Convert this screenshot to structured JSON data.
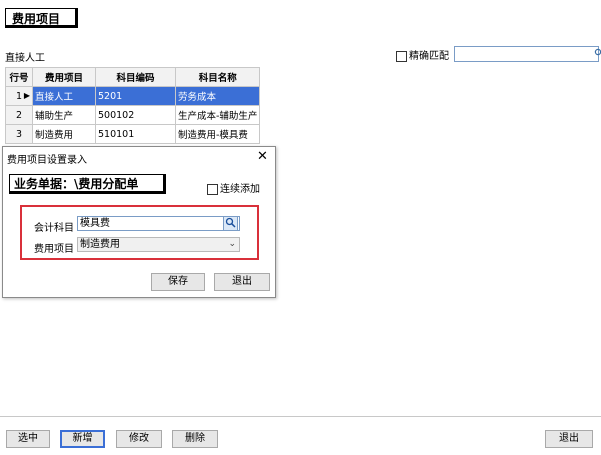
{
  "header": {
    "title": "费用项目"
  },
  "filter": {
    "label": "直接人工",
    "exact_match_label": "精确匹配",
    "exact_match_checked": false,
    "search_value": ""
  },
  "table": {
    "columns": [
      "行号",
      "费用项目",
      "科目编码",
      "科目名称"
    ],
    "rows": [
      {
        "num": "1",
        "item": "直接人工",
        "code": "5201",
        "name": "劳务成本",
        "selected": true
      },
      {
        "num": "2",
        "item": "辅助生产",
        "code": "500102",
        "name": "生产成本-辅助生产"
      },
      {
        "num": "3",
        "item": "制造费用",
        "code": "510101",
        "name": "制造费用-模具费"
      }
    ]
  },
  "dialog": {
    "title": "费用项目设置录入",
    "close_glyph": "✕",
    "biz_label": "业务单据：\\费用分配单",
    "continuous_add_label": "连续添加",
    "continuous_add_checked": false,
    "account_label": "会计科目",
    "account_value": "模具费",
    "item_label": "费用项目",
    "item_value": "制造费用",
    "save_label": "保存",
    "exit_label": "退出"
  },
  "bottom": {
    "select_label": "选中",
    "add_label": "新增",
    "edit_label": "修改",
    "delete_label": "删除",
    "exit_label": "退出"
  },
  "colors": {
    "selection": "#3b6fd6",
    "highlight_border": "#d9303a"
  },
  "icons": {
    "search": "search-icon",
    "lookup": "magnifier-icon",
    "dropdown": "chevron-down-icon",
    "row_pointer": "row-pointer-icon"
  }
}
